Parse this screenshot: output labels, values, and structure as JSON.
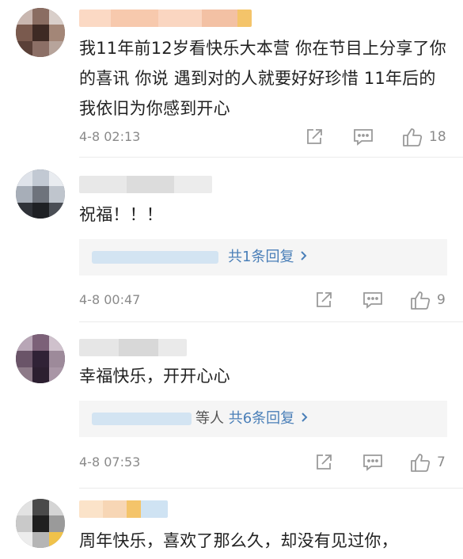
{
  "comments": [
    {
      "text": "我11年前12岁看快乐大本营 你在节目上分享了你的喜讯 你说 遇到对的人就要好好珍惜 11年后的我依旧为你感到开心",
      "time": "4-8 02:13",
      "likes": "18"
    },
    {
      "text": "祝福！！！",
      "time": "4-8 00:47",
      "likes": "9",
      "reply": {
        "summary": "共1条回复"
      }
    },
    {
      "text": "幸福快乐，开开心心",
      "time": "4-8 07:53",
      "likes": "7",
      "reply": {
        "prefix": "等人",
        "summary": "共6条回复"
      }
    },
    {
      "text": "周年快乐，喜欢了那么久，却没有见过你，"
    }
  ],
  "icons": {
    "share": "share-icon",
    "comment": "comment-icon",
    "like": "thumbs-up-icon",
    "chevron": "chevron-right-icon"
  },
  "colors": {
    "link": "#4a7fb8",
    "meta": "#8a8a8a",
    "icon": "#9a9a9a"
  }
}
